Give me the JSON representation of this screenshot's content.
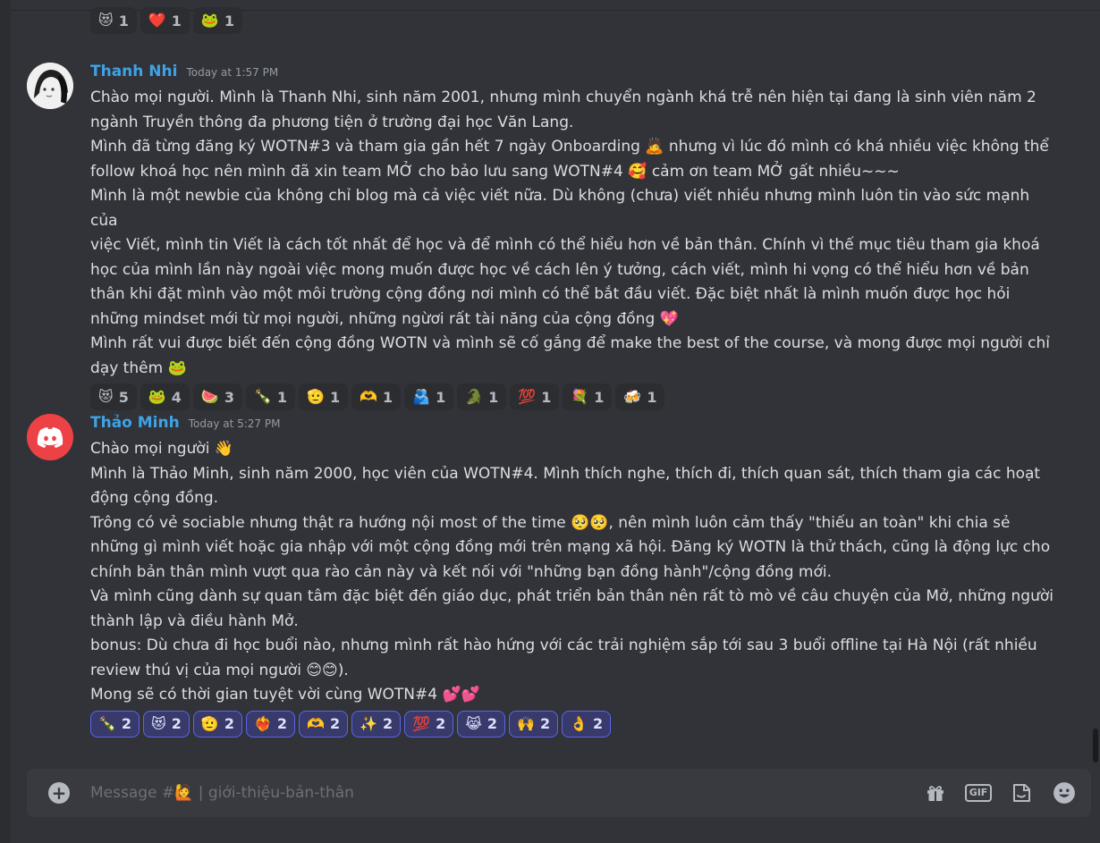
{
  "top_reactions": [
    {
      "emoji": "😻",
      "count": "1"
    },
    {
      "emoji": "❤️",
      "count": "1"
    },
    {
      "emoji": "🐸",
      "count": "1"
    }
  ],
  "messages": [
    {
      "author": "Thanh Nhi",
      "timestamp": "Today at 1:57 PM",
      "lines": [
        "Chào mọi người. Mình là Thanh Nhi, sinh năm 2001, nhưng mình chuyển ngành khá trễ nên hiện tại đang là sinh viên năm 2",
        "ngành Truyền thông đa phương tiện ở trường đại học Văn Lang.",
        "Mình đã từng đăng ký WOTN#3 và tham gia gần hết 7 ngày Onboarding 🙇 nhưng vì lúc đó mình có khá nhiều việc không thể",
        "follow khoá học nên mình đã xin team MỞ cho bảo lưu sang WOTN#4 🥰 cảm ơn team MỞ gất nhiều~~~",
        "Mình là một newbie của không chỉ blog mà cả việc viết nữa. Dù không (chưa) viết nhiều nhưng mình luôn tin vào sức mạnh của",
        "việc Viết, mình tin Viết là cách tốt nhất để học và để mình có thể hiểu hơn về bản thân. Chính vì thế mục tiêu tham gia khoá",
        "học của mình lần này ngoài việc mong muốn được học về cách lên ý tưởng, cách viết, mình hi vọng có thể hiểu hơn về bản",
        "thân khi đặt mình vào một môi trường cộng đồng nơi mình có thể bắt đầu viết. Đặc biệt nhất là mình muốn được học hỏi",
        "những mindset mới từ mọi người, những ngừơi rất tài năng của cộng đồng 💖",
        "Mình rất vui được biết đến cộng đồng WOTN và mình sẽ cố gắng để make the best of the course, và mong được mọi người chỉ",
        "dạy thêm 🐸"
      ],
      "reactions": [
        {
          "emoji": "😻",
          "count": "5"
        },
        {
          "emoji": "🐸",
          "count": "4"
        },
        {
          "emoji": "🍉",
          "count": "3"
        },
        {
          "emoji": "🍾",
          "count": "1"
        },
        {
          "emoji": "🫡",
          "count": "1"
        },
        {
          "emoji": "🫶",
          "count": "1"
        },
        {
          "emoji": "🫂",
          "count": "1"
        },
        {
          "emoji": "🐊",
          "count": "1"
        },
        {
          "emoji": "💯",
          "count": "1"
        },
        {
          "emoji": "💐",
          "count": "1"
        },
        {
          "emoji": "🍻",
          "count": "1"
        }
      ]
    },
    {
      "author": "Thảo Minh",
      "timestamp": "Today at 5:27 PM",
      "lines": [
        "Chào mọi người 👋",
        "Mình là Thảo Minh, sinh năm 2000, học viên của WOTN#4. Mình thích nghe, thích đi, thích quan sát, thích tham gia các hoạt",
        "động cộng đồng.",
        "Trông có vẻ sociable nhưng thật ra hướng nội most of the time 🥺🥺, nên mình luôn cảm thấy \"thiếu an toàn\" khi chia sẻ",
        "những gì mình viết hoặc gia nhập với một cộng đồng mới trên mạng xã hội. Đăng ký WOTN là thử thách, cũng là động lực cho",
        "chính bản thân mình vượt qua rào cản này và kết nối với \"những bạn đồng hành\"/cộng đồng mới.",
        "Và mình cũng dành sự quan tâm đặc biệt đến giáo dục, phát triển bản thân nên rất tò mò về câu chuyện của Mở, những người",
        "thành lập và điều hành Mở.",
        "bonus: Dù chưa đi học buổi nào, nhưng mình rất hào hứng với các trải nghiệm sắp tới sau 3 buổi offline tại Hà Nội (rất nhiều",
        "review thú vị của mọi người 😊😊).",
        "Mong sẽ có thời gian tuyệt vời cùng WOTN#4 💕💕"
      ],
      "reactions": [
        {
          "emoji": "🍾",
          "count": "2"
        },
        {
          "emoji": "😻",
          "count": "2"
        },
        {
          "emoji": "🫡",
          "count": "2"
        },
        {
          "emoji": "❤️‍🔥",
          "count": "2"
        },
        {
          "emoji": "🫶",
          "count": "2"
        },
        {
          "emoji": "✨",
          "count": "2"
        },
        {
          "emoji": "💯",
          "count": "2"
        },
        {
          "emoji": "😹",
          "count": "2"
        },
        {
          "emoji": "🙌",
          "count": "2"
        },
        {
          "emoji": "👌",
          "count": "2"
        }
      ]
    }
  ],
  "composer": {
    "placeholder": "Message #🙋 | giới-thiệu-bản-thân",
    "gif_label": "GIF"
  },
  "colors": {
    "background": "#313338",
    "author": "#3ea3e6",
    "discord_red": "#ed4245"
  }
}
